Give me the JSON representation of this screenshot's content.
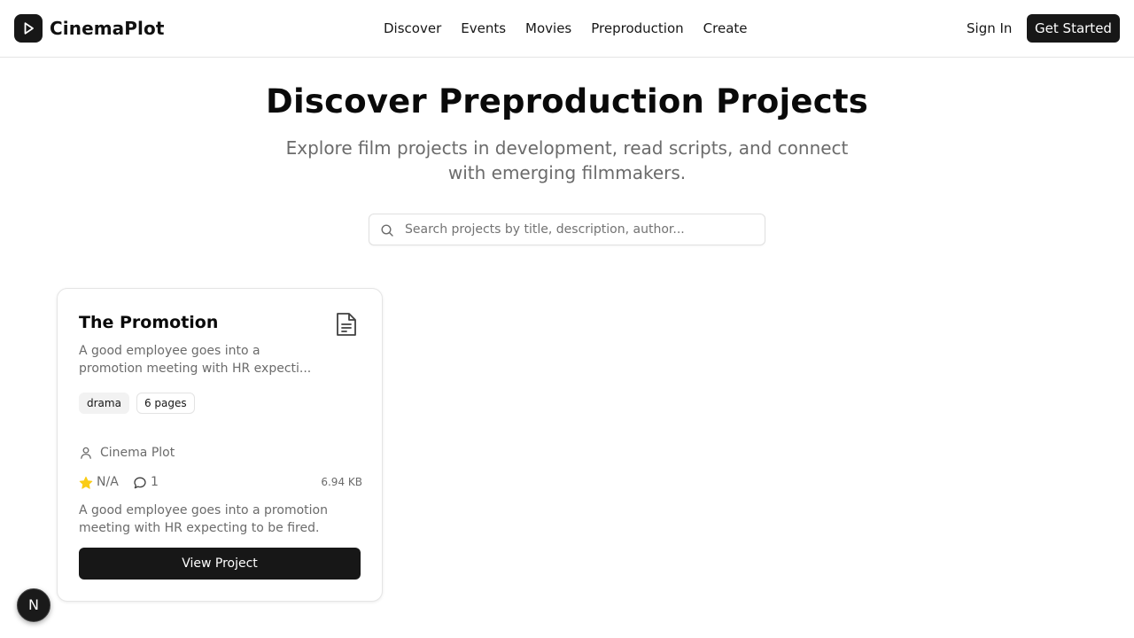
{
  "app": {
    "name": "CinemaPlot",
    "logo_icon": "play-icon"
  },
  "nav": {
    "items": [
      {
        "label": "Discover"
      },
      {
        "label": "Events"
      },
      {
        "label": "Movies"
      },
      {
        "label": "Preproduction"
      },
      {
        "label": "Create"
      }
    ]
  },
  "auth": {
    "sign_in_label": "Sign In",
    "get_started_label": "Get Started"
  },
  "hero": {
    "title": "Discover Preproduction Projects",
    "subtitle": "Explore film projects in development, read scripts, and connect with emerging filmmakers."
  },
  "search": {
    "icon": "search-icon",
    "placeholder": "Search projects by title, description, author...",
    "value": ""
  },
  "projects": [
    {
      "title": "The Promotion",
      "icon": "document-icon",
      "description": "A good employee goes into a promotion meeting with HR expecti...",
      "genre": "drama",
      "pages": "6 pages",
      "author": "Cinema Plot",
      "rating": "N/A",
      "comments": "1",
      "file_size": "6.94 KB",
      "summary": "A good employee goes into a promotion meeting with HR expecting to be fired.",
      "action_label": "View Project"
    }
  ],
  "floating_badge": {
    "label": "N"
  },
  "colors": {
    "primary": "#171717",
    "muted_text": "#6b6b6b",
    "star": "#facc15",
    "border": "#e5e5e5"
  }
}
